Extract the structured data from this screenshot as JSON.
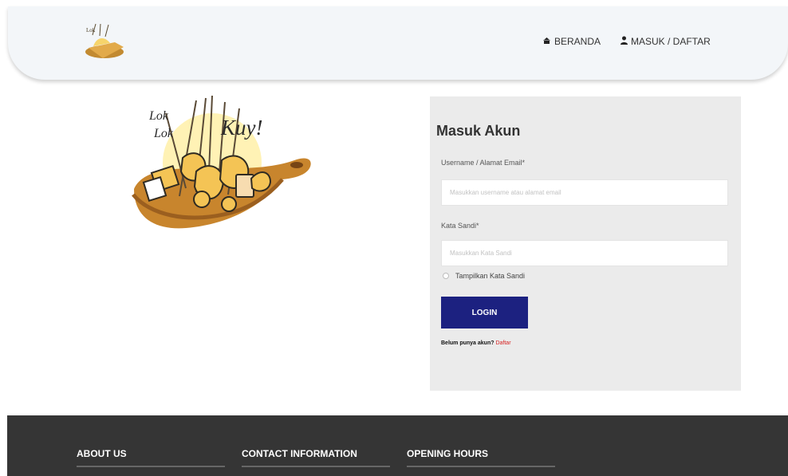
{
  "header": {
    "logo_alt": "Lok Lok Kuy logo",
    "nav_home": "BERANDA",
    "nav_login": "MASUK / DAFTAR"
  },
  "hero": {
    "logo_text_lines": [
      "Lok",
      "Lok",
      "Kuy!"
    ]
  },
  "login": {
    "title": "Masuk Akun",
    "username_label": "Username / Alamat Email*",
    "username_placeholder": "Masukkan username atau alamat email",
    "password_label": "Kata Sandi*",
    "password_placeholder": "Masukkan Kata Sandi",
    "show_password_label": "Tampilkan Kata Sandi",
    "login_button": "LOGIN",
    "signup_prompt": "Belum punya akun?",
    "signup_link": "Daftar"
  },
  "footer": {
    "about": "ABOUT US",
    "contact": "CONTACT INFORMATION",
    "hours": "OPENING HOURS"
  },
  "colors": {
    "header_background": "#f3f6f9",
    "form_panel": "#ebebeb",
    "login_button": "#1c2180",
    "signup_link": "#d72323",
    "footer": "#353535"
  },
  "icons": {
    "home": "home-icon",
    "user": "user-icon"
  }
}
